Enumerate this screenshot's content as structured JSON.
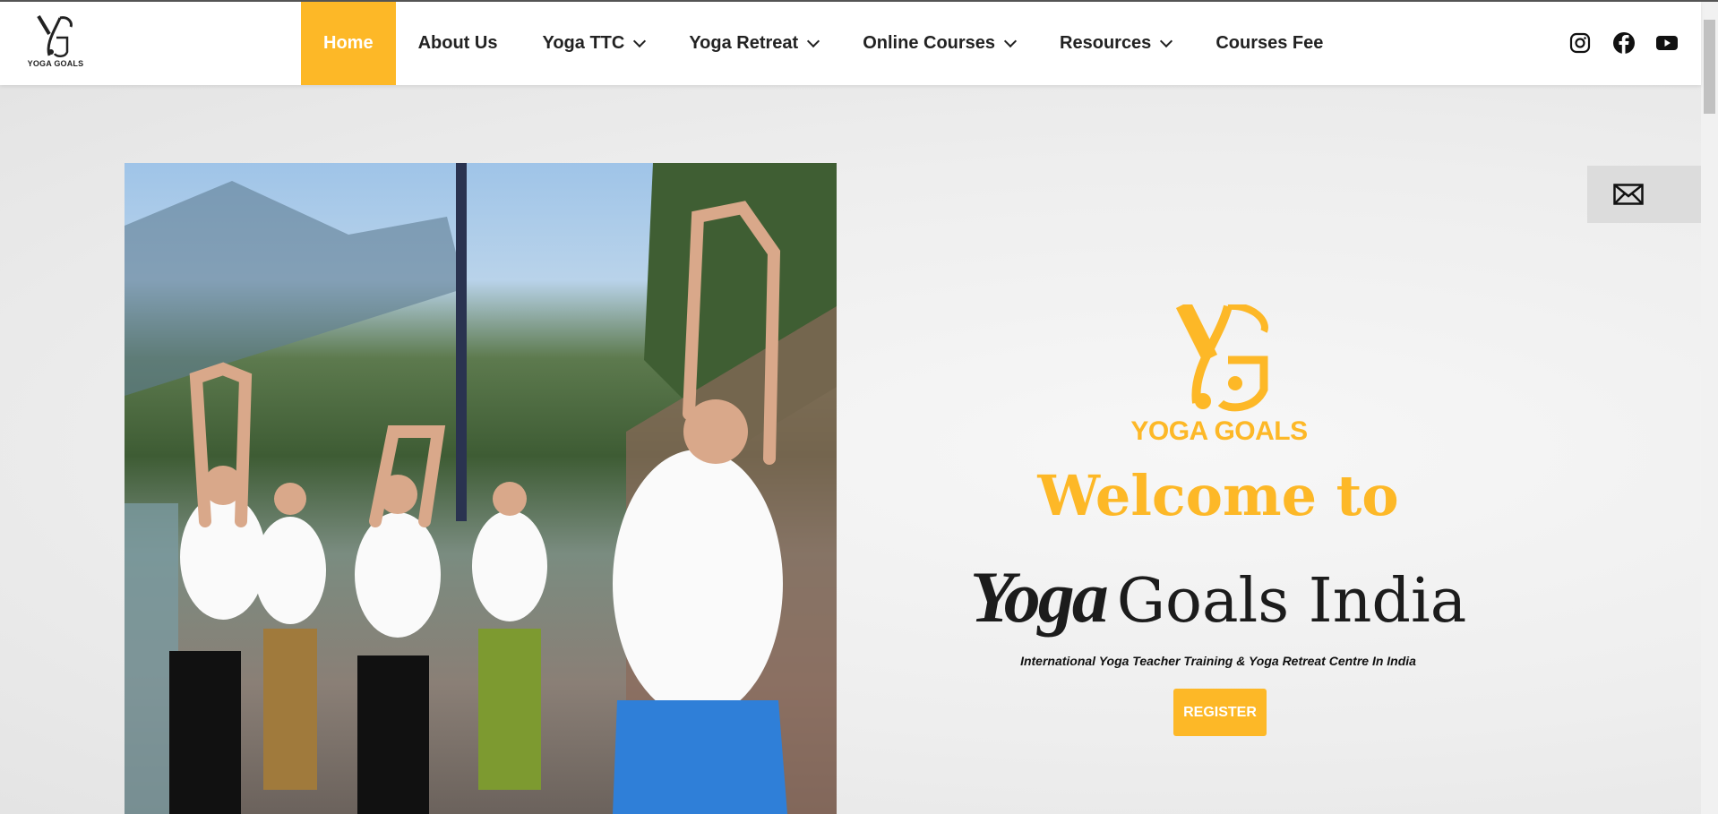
{
  "brand": {
    "logo_text": "YOGA GOALS",
    "accent": "#fdb827"
  },
  "nav": {
    "items": [
      {
        "label": "Home",
        "active": true,
        "dropdown": false
      },
      {
        "label": "About Us",
        "dropdown": false
      },
      {
        "label": "Yoga TTC",
        "dropdown": true
      },
      {
        "label": "Yoga Retreat",
        "dropdown": true
      },
      {
        "label": "Online Courses",
        "dropdown": true
      },
      {
        "label": "Resources",
        "dropdown": true
      },
      {
        "label": "Courses Fee",
        "dropdown": false
      }
    ],
    "social": [
      "instagram-icon",
      "facebook-icon",
      "youtube-icon"
    ]
  },
  "hero": {
    "logo_text": "YOGA GOALS",
    "welcome": "Welcome to",
    "title_script": "Yoga",
    "title_rest": "Goals India",
    "tagline": "International Yoga Teacher Training & Yoga Retreat Centre In India",
    "register_label": "REGISTER"
  },
  "contact_widget": {
    "icon": "mail-icon"
  }
}
